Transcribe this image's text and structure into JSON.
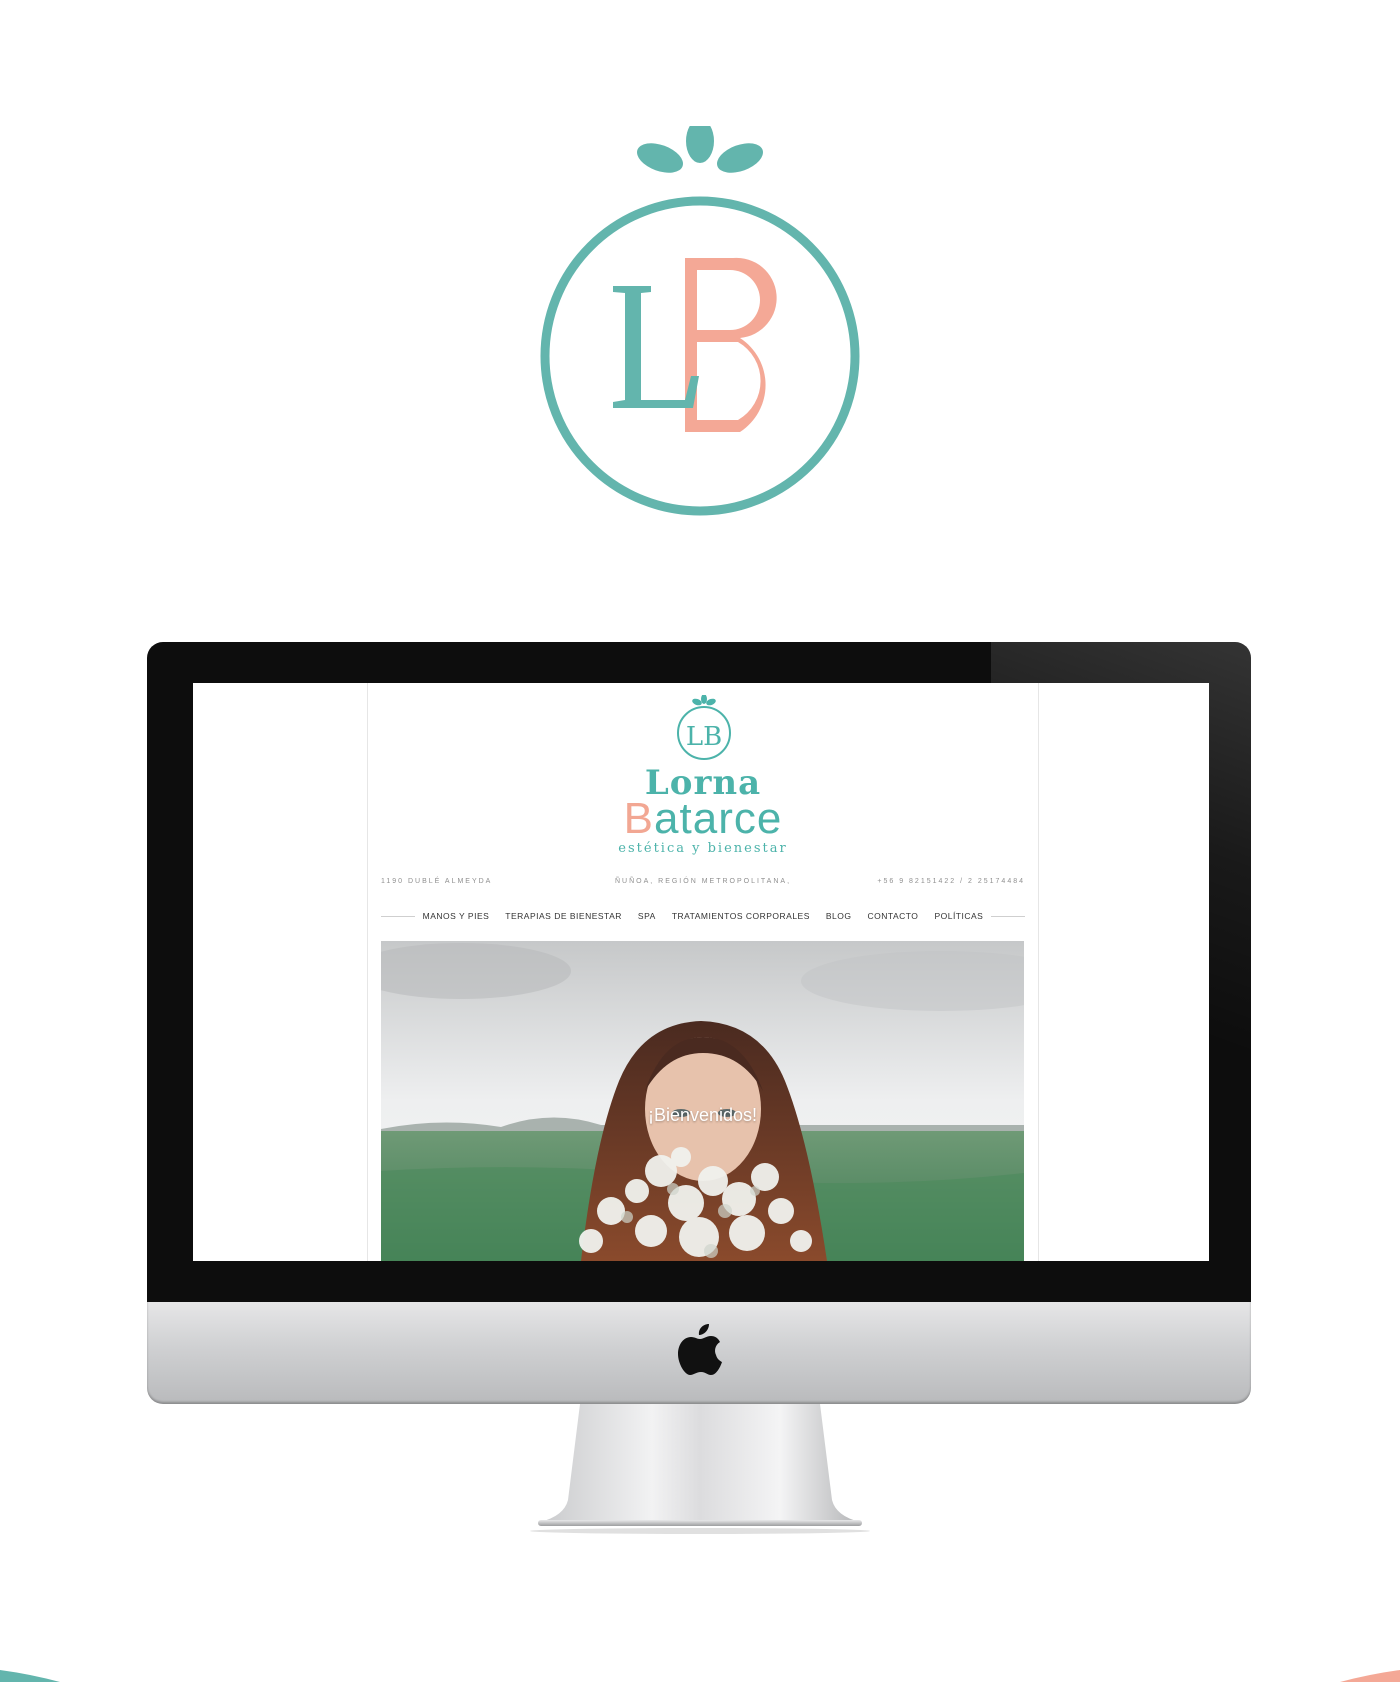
{
  "brand": {
    "logo_monogram": "LB",
    "name_line1": "Lorna",
    "name_line2_initial": "B",
    "name_line2_rest": "atarce",
    "tagline": "estética y bienestar",
    "colors": {
      "teal": "#63b5ad",
      "salmon": "#f4a896",
      "wordmark_teal": "#4cb3aa"
    }
  },
  "site": {
    "info": {
      "address": "1190 DUBLÉ ALMEYDA",
      "city": "ÑUÑOA, REGIÓN METROPOLITANA,",
      "phone": "+56 9 82151422 / 2 25174484"
    },
    "nav": [
      {
        "label": "MANOS Y PIES"
      },
      {
        "label": "TERAPIAS DE BIENESTAR"
      },
      {
        "label": "SPA"
      },
      {
        "label": "TRATAMIENTOS CORPORALES"
      },
      {
        "label": "BLOG"
      },
      {
        "label": "CONTACTO"
      },
      {
        "label": "POLÍTICAS"
      }
    ],
    "hero": {
      "text": "¡Bienvenidos!"
    }
  },
  "device": {
    "icon": "apple-icon"
  }
}
